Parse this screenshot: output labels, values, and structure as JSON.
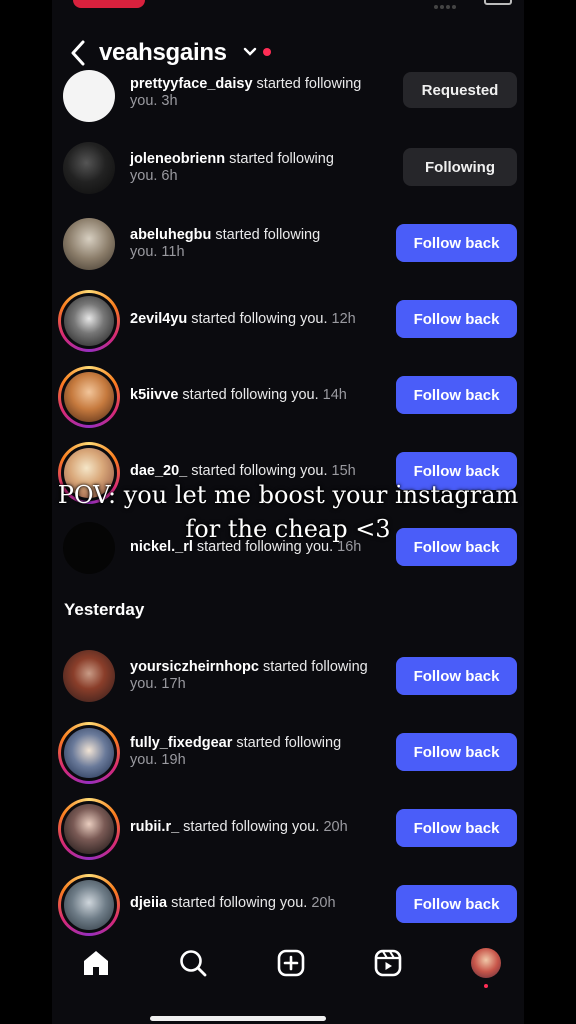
{
  "header": {
    "username": "veahsgains"
  },
  "rows": [
    {
      "username": "prettyyface_daisy",
      "action": " started following",
      "time": "you. 3h",
      "button": "Requested"
    },
    {
      "username": "joleneobrienn",
      "action": " started following",
      "time": "you. 6h",
      "button": "Following"
    },
    {
      "username": "abeluhegbu",
      "action": " started following",
      "time": "you. 11h",
      "button": "Follow back"
    },
    {
      "username": "2evil4yu",
      "action": " started following you.",
      "time": "12h",
      "button": "Follow back"
    },
    {
      "username": "k5iivve",
      "action": " started following you.",
      "time": "14h",
      "button": "Follow back"
    },
    {
      "username": "dae_20_",
      "action": " started following you.",
      "time": "15h",
      "button": "Follow back"
    },
    {
      "username": "nickel._rl",
      "action": " started following you.",
      "time": "16h",
      "button": "Follow back"
    },
    {
      "username": "yoursiczheirnhopc",
      "action": " started following",
      "time": "you. 17h",
      "button": "Follow back"
    },
    {
      "username": "fully_fixedgear",
      "action": " started following",
      "time": "you. 19h",
      "button": "Follow back"
    },
    {
      "username": "rubii.r_",
      "action": " started following you.",
      "time": "20h",
      "button": "Follow back"
    },
    {
      "username": "djeiia",
      "action": " started following you.",
      "time": "20h",
      "button": "Follow back"
    }
  ],
  "section_label": "Yesterday",
  "overlay": {
    "line1": "POV: you let me boost your instagram",
    "line2": "for the cheap <3"
  },
  "colors": {
    "accent": "#4a5df9",
    "background": "#0b0b0f",
    "notification": "#ff2d55"
  },
  "nav": [
    "home-icon",
    "search-icon",
    "create-icon",
    "reels-icon",
    "profile-avatar"
  ]
}
